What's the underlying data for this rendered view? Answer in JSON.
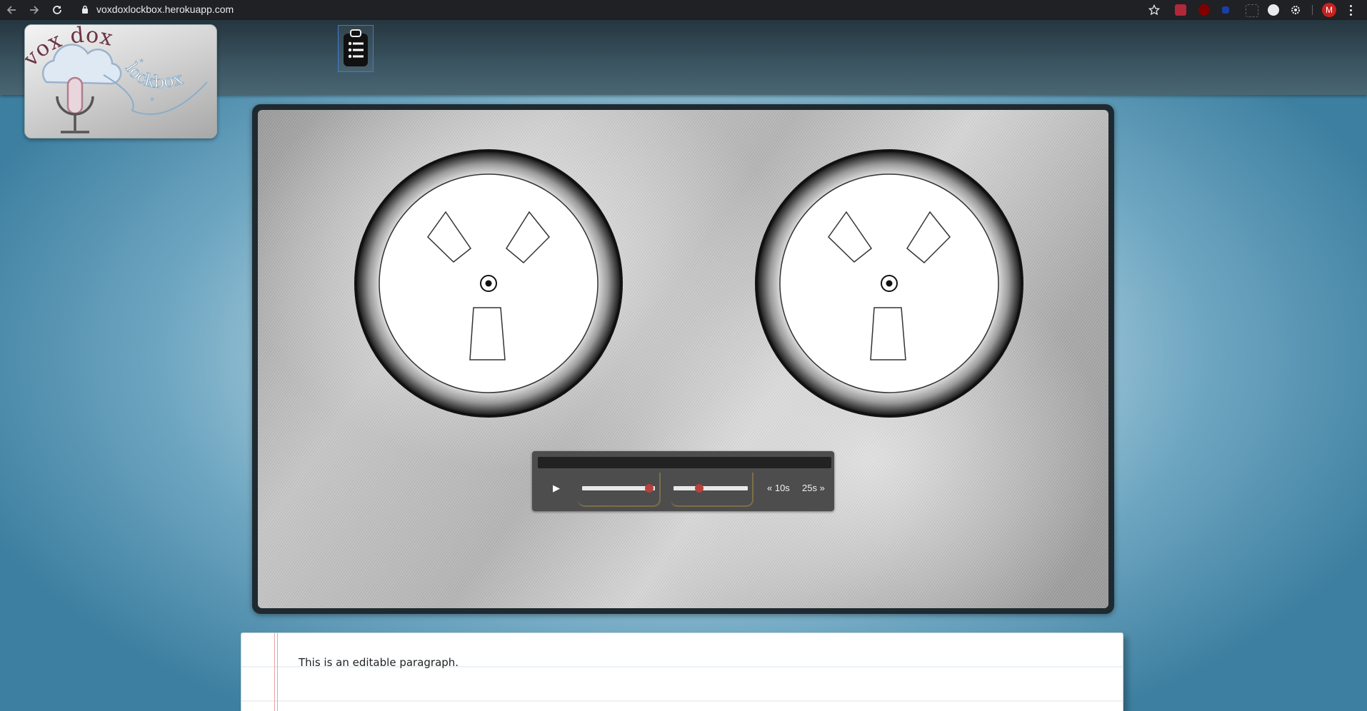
{
  "browser": {
    "url": "voxdoxlockbox.herokuapp.com",
    "profile_initial": "M"
  },
  "logo": {
    "word_top": "vox dox",
    "word_bottom": "lockbox"
  },
  "player": {
    "play_symbol": "▶",
    "skip_back_label": "« 10s",
    "skip_forward_label": "25s »",
    "progress_fraction": 0.92,
    "volume_fraction": 0.35,
    "accent_color": "#b8413e"
  },
  "editor": {
    "paragraph_text": "This is an editable paragraph."
  },
  "icons": {
    "clipboard": "clipboard-list-icon"
  }
}
